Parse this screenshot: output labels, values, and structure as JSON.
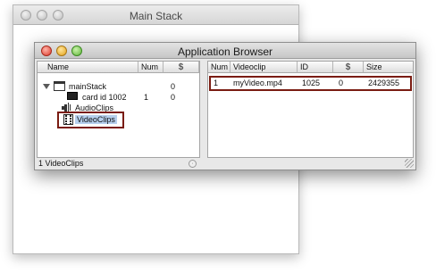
{
  "main_window": {
    "title": "Main Stack"
  },
  "app_browser": {
    "title": "Application Browser",
    "left_pane": {
      "headers": {
        "name": "Name",
        "num": "Num",
        "script": "$"
      },
      "rows": [
        {
          "name": "mainStack",
          "num": "",
          "script": "0",
          "icon": "stack-icon"
        },
        {
          "name": "card id 1002",
          "num": "1",
          "script": "0",
          "icon": "card-icon"
        },
        {
          "name": "AudioClips",
          "num": "",
          "script": "",
          "icon": "audio-icon"
        },
        {
          "name": "VideoClips",
          "num": "",
          "script": "",
          "icon": "film-icon",
          "selected": true
        }
      ],
      "status": "1 VideoClips"
    },
    "right_pane": {
      "headers": {
        "num": "Num",
        "videoclip": "Videoclip",
        "id": "ID",
        "script": "$",
        "size": "Size"
      },
      "rows": [
        {
          "num": "1",
          "videoclip": "myVideo.mp4",
          "id": "1025",
          "script": "0",
          "size": "2429355"
        }
      ]
    }
  },
  "colors": {
    "highlight_border": "#7a1c12",
    "selection": "#b6cfee"
  }
}
